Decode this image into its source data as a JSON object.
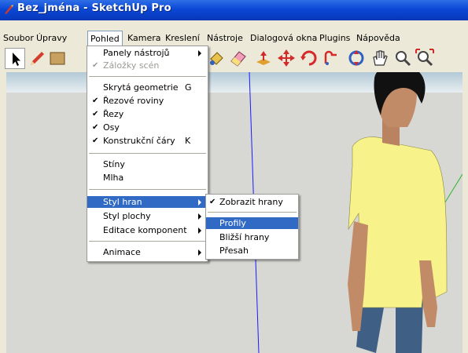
{
  "window": {
    "title": "Bez_jména - SketchUp Pro",
    "title_color": "#0a47d6"
  },
  "menubar": {
    "items": [
      "Soubor",
      "Úpravy",
      "Pohled",
      "Kamera",
      "Kreslení",
      "Nástroje",
      "Dialogová okna",
      "Plugins",
      "Nápověda"
    ],
    "active": "Pohled"
  },
  "toolbar": {
    "tools": [
      "select-arrow-icon",
      "pencil-icon",
      "rectangle-icon",
      "paint-bucket-icon",
      "eraser-icon",
      "push-pull-icon",
      "move-icon",
      "rotate-icon",
      "follow-me-icon",
      "orbit-icon",
      "pan-icon",
      "zoom-icon",
      "zoom-extents-icon"
    ],
    "selected": "select-arrow-icon"
  },
  "view_menu": {
    "items": [
      {
        "label": "Panely nástrojů",
        "submenu": true
      },
      {
        "label": "Záložky scén",
        "checked": true,
        "disabled": true
      },
      {
        "label": "Skrytá geometrie",
        "shortcut": "G"
      },
      {
        "label": "Řezové roviny",
        "checked": true
      },
      {
        "label": "Řezy",
        "checked": true
      },
      {
        "label": "Osy",
        "checked": true
      },
      {
        "label": "Konstrukční čáry",
        "checked": true,
        "shortcut": "K"
      },
      {
        "label": "Stíny"
      },
      {
        "label": "Mlha"
      },
      {
        "label": "Styl hran",
        "submenu": true,
        "highlighted": true
      },
      {
        "label": "Styl plochy",
        "submenu": true
      },
      {
        "label": "Editace komponent",
        "submenu": true
      },
      {
        "label": "Animace",
        "submenu": true
      }
    ],
    "check_glyph": "✔"
  },
  "edge_style_submenu": {
    "items": [
      {
        "label": "Zobrazit hrany",
        "checked": true
      },
      {
        "label": "Profily",
        "highlighted": true
      },
      {
        "label": "Bližší hrany"
      },
      {
        "label": "Přesah"
      }
    ]
  },
  "colors": {
    "highlight": "#316ac5",
    "menu_bg": "#ece9d8",
    "axis_blue": "#1a1aff",
    "axis_green": "#2db52d"
  }
}
